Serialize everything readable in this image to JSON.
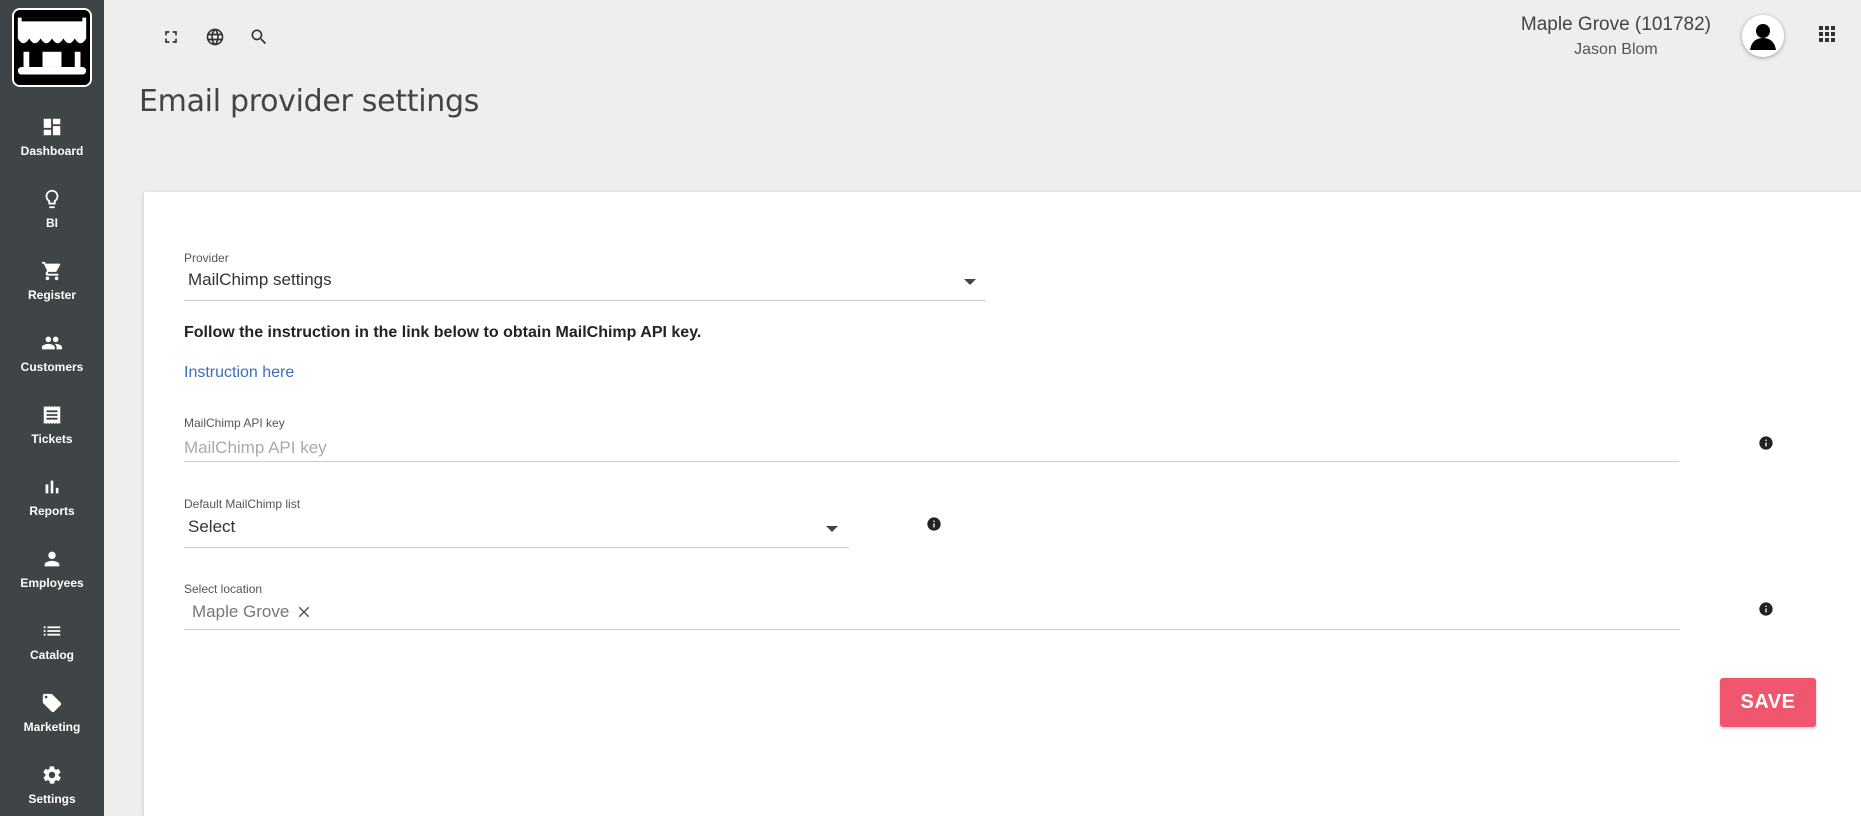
{
  "header": {
    "location": "Maple Grove (101782)",
    "user_name": "Jason Blom",
    "icons": [
      "fullscreen-icon",
      "globe-icon",
      "search-icon",
      "avatar-icon",
      "apps-grid-icon"
    ]
  },
  "sidebar": {
    "items": [
      {
        "label": "Dashboard",
        "icon": "dashboard-icon"
      },
      {
        "label": "BI",
        "icon": "lightbulb-icon"
      },
      {
        "label": "Register",
        "icon": "cart-icon"
      },
      {
        "label": "Customers",
        "icon": "people-icon"
      },
      {
        "label": "Tickets",
        "icon": "receipt-icon"
      },
      {
        "label": "Reports",
        "icon": "bar-chart-icon"
      },
      {
        "label": "Employees",
        "icon": "person-icon"
      },
      {
        "label": "Catalog",
        "icon": "list-icon"
      },
      {
        "label": "Marketing",
        "icon": "tag-icon"
      },
      {
        "label": "Settings",
        "icon": "gear-icon"
      }
    ]
  },
  "page": {
    "title": "Email provider settings"
  },
  "form": {
    "provider_label": "Provider",
    "provider_value": "MailChimp settings",
    "instruction_text": "Follow the instruction in the link below to obtain MailChimp API key.",
    "instruction_link": "Instruction here",
    "api_key_label": "MailChimp API key",
    "api_key_placeholder": "MailChimp API key",
    "api_key_value": "",
    "list_label": "Default MailChimp list",
    "list_value": "Select",
    "location_label": "Select location",
    "location_chip": "Maple Grove",
    "save_label": "SAVE"
  },
  "colors": {
    "sidebar_bg": "#3f4446",
    "page_bg": "#eeeeee",
    "card_bg": "#ffffff",
    "link": "#3b6fb6",
    "save_button": "#f0566e"
  }
}
